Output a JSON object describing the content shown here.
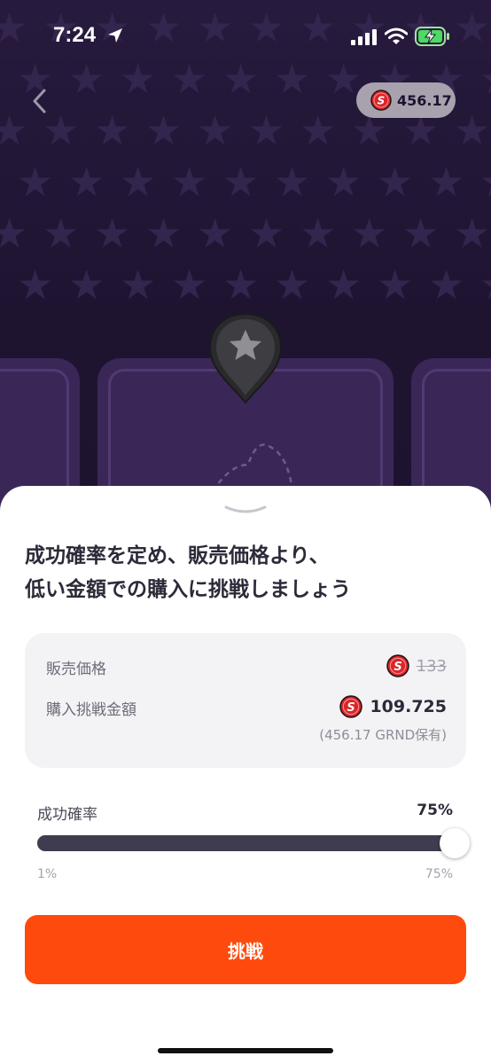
{
  "status_bar": {
    "time": "7:24"
  },
  "header": {
    "balance": "456.17"
  },
  "colors": {
    "accent": "#ff4a0d",
    "coin": "#d8262a",
    "background": "#1f1530",
    "slider_fill": "#3f3c4f"
  },
  "icons": [
    "location-arrow-icon",
    "signal-icon",
    "wifi-icon",
    "battery-charging-icon",
    "back-chevron-icon",
    "coin-icon",
    "star-pin-icon",
    "sheet-handle-icon"
  ],
  "sheet": {
    "heading_line1": "成功確率を定め、販売価格より、",
    "heading_line2": "低い金額での購入に挑戦しましょう",
    "sale_price_label": "販売価格",
    "sale_price": "133",
    "bid_amount_label": "購入挑戦金額",
    "bid_amount": "109.725",
    "holding_note": "(456.17 GRND保有)",
    "success_rate_label": "成功確率",
    "success_rate_value": "75%",
    "success_rate_level": 1.0,
    "range_min": "1%",
    "range_max": "75%",
    "challenge_button": "挑戦"
  }
}
